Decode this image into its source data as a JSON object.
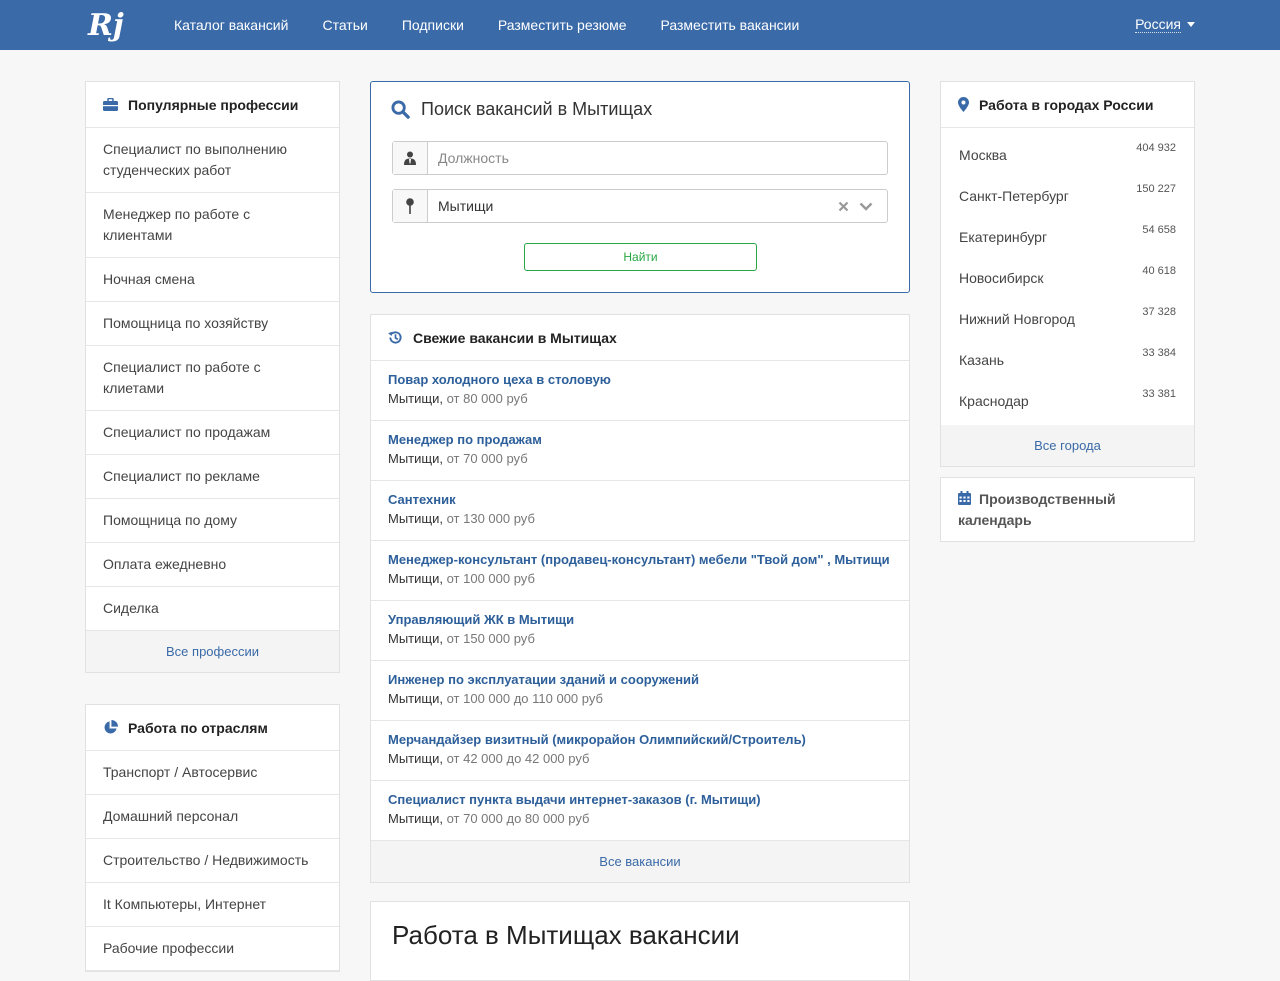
{
  "colors": {
    "brand": "#3a6aa8",
    "link": "#2d5f9a",
    "success": "#28a745"
  },
  "navbar": {
    "logo_text": "Rj",
    "links": [
      "Каталог вакансий",
      "Статьи",
      "Подписки",
      "Разместить резюме",
      "Разместить вакансии"
    ],
    "country": "Россия"
  },
  "popular_professions": {
    "title": "Популярные профессии",
    "icon": "briefcase-icon",
    "items": [
      "Специалист по выполнению студенческих работ",
      "Менеджер по работе с клиентами",
      "Ночная смена",
      "Помощница по хозяйству",
      "Специалист по работе с клиетами",
      "Специалист по продажам",
      "Специалист по рекламе",
      "Помощница по дому",
      "Оплата ежедневно",
      "Сиделка"
    ],
    "footer": "Все профессии"
  },
  "industries": {
    "title": "Работа по отраслям",
    "icon": "pie-chart-icon",
    "items": [
      "Транспорт / Автосервис",
      "Домашний персонал",
      "Строительство / Недвижимость",
      "It Компьютеры, Интернет",
      "Рабочие профессии"
    ]
  },
  "search": {
    "title": "Поиск вакансий в Мытищах",
    "position_placeholder": "Должность",
    "city_value": "Мытищи",
    "button": "Найти"
  },
  "fresh": {
    "title": "Свежие вакансии в Мытищах",
    "icon": "history-icon",
    "items": [
      {
        "title": "Повар холодного цеха в столовую",
        "city": "Мытищи,",
        "salary": "от 80 000 руб"
      },
      {
        "title": "Менеджер по продажам",
        "city": "Мытищи,",
        "salary": "от 70 000 руб"
      },
      {
        "title": "Сантехник",
        "city": "Мытищи,",
        "salary": "от 130 000 руб"
      },
      {
        "title": "Менеджер-консультант (продавец-консультант) мебели \"Твой дом\" , Мытищи",
        "city": "Мытищи,",
        "salary": "от 100 000 руб"
      },
      {
        "title": "Управляющий ЖК в Мытищи",
        "city": "Мытищи,",
        "salary": "от 150 000 руб"
      },
      {
        "title": "Инженер по эксплуатации зданий и сооружений",
        "city": "Мытищи,",
        "salary": "от 100 000 до 110 000 руб"
      },
      {
        "title": "Мерчандайзер визитный (микрорайон Олимпийский/Строитель)",
        "city": "Мытищи,",
        "salary": "от 42 000 до 42 000 руб"
      },
      {
        "title": "Специалист пункта выдачи интернет-заказов (г. Мытищи)",
        "city": "Мытищи,",
        "salary": "от 70 000 до 80 000 руб"
      }
    ],
    "footer": "Все вакансии"
  },
  "content": {
    "title": "Работа в Мытищах вакансии"
  },
  "cities": {
    "title": "Работа в городах России",
    "icon": "map-marker-icon",
    "items": [
      {
        "name": "Москва",
        "count": "404 932"
      },
      {
        "name": "Санкт-Петербург",
        "count": "150 227"
      },
      {
        "name": "Екатеринбург",
        "count": "54 658"
      },
      {
        "name": "Новосибирск",
        "count": "40 618"
      },
      {
        "name": "Нижний Новгород",
        "count": "37 328"
      },
      {
        "name": "Казань",
        "count": "33 384"
      },
      {
        "name": "Краснодар",
        "count": "33 381"
      }
    ],
    "footer": "Все города"
  },
  "calendar": {
    "title": "Производственный календарь",
    "icon": "calendar-icon"
  }
}
